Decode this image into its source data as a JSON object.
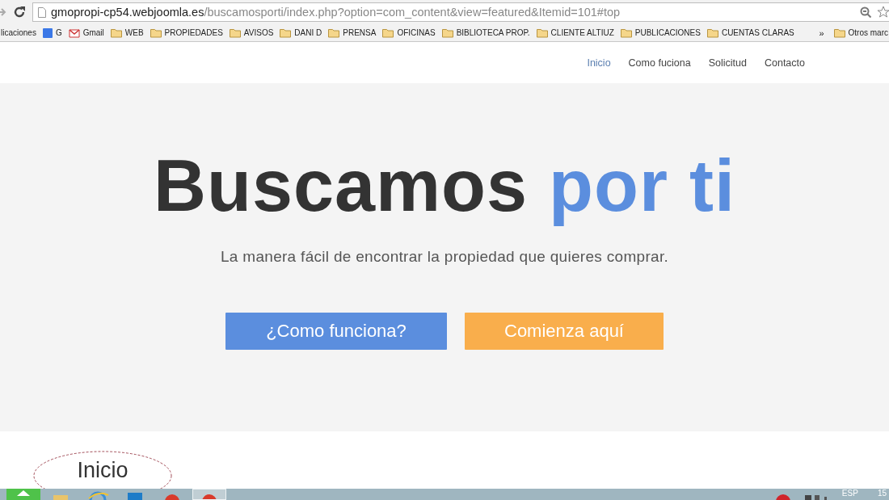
{
  "browser": {
    "url_host": "gmopropi-cp54.webjoomla.es",
    "url_path": "/buscamosporti/index.php?option=com_content&view=featured&Itemid=101#top",
    "bookmarks": [
      {
        "label": "licaciones",
        "kind": "plain"
      },
      {
        "label": "G",
        "kind": "google"
      },
      {
        "label": "Gmail",
        "kind": "gmail"
      },
      {
        "label": "WEB",
        "kind": "folder"
      },
      {
        "label": "PROPIEDADES",
        "kind": "folder"
      },
      {
        "label": "AVISOS",
        "kind": "folder"
      },
      {
        "label": "DANI D",
        "kind": "folder"
      },
      {
        "label": "PRENSA",
        "kind": "folder"
      },
      {
        "label": "OFICINAS",
        "kind": "folder"
      },
      {
        "label": "BIBLIOTECA PROP.",
        "kind": "folder"
      },
      {
        "label": "CLIENTE ALTIUZ",
        "kind": "folder"
      },
      {
        "label": "PUBLICACIONES",
        "kind": "folder"
      },
      {
        "label": "CUENTAS CLARAS",
        "kind": "folder"
      }
    ],
    "overflow": "»",
    "other_bookmarks": "Otros marc"
  },
  "nav": [
    {
      "label": "Inicio",
      "selected": true
    },
    {
      "label": "Como fuciona",
      "selected": false
    },
    {
      "label": "Solicitud",
      "selected": false
    },
    {
      "label": "Contacto",
      "selected": false
    }
  ],
  "hero": {
    "title": "Buscamos",
    "title_accent": "por ti",
    "subtitle": "La manera fácil de encontrar la propiedad que quieres comprar.",
    "buttons": [
      {
        "label": "¿Como funciona?",
        "color": "#5b8ede"
      },
      {
        "label": "Comienza aquí",
        "color": "#f9ae4c"
      }
    ]
  },
  "section_heading": "Inicio",
  "taskbar": {
    "apps": [
      {
        "kind": "start",
        "selected": false
      },
      {
        "kind": "folder",
        "selected": false
      },
      {
        "kind": "ie",
        "selected": false
      },
      {
        "kind": "blue",
        "selected": false
      },
      {
        "kind": "chrome",
        "selected": false
      },
      {
        "kind": "chrome",
        "selected": true
      }
    ],
    "language": "ESP",
    "clock": "15"
  }
}
